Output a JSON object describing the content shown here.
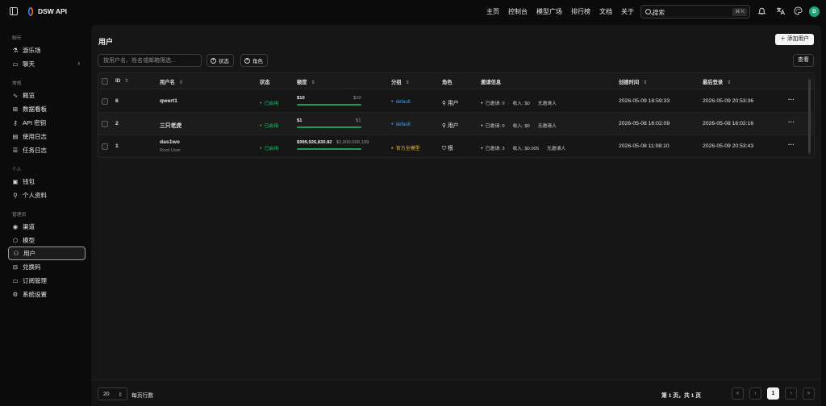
{
  "app": {
    "title": "DSW API",
    "user_initial": "D"
  },
  "topnav": [
    "主页",
    "控制台",
    "模型广场",
    "排行榜",
    "文档",
    "关于"
  ],
  "search": {
    "placeholder": "搜索",
    "shortcut": "⌘ K"
  },
  "sidebar": {
    "sections": {
      "chat": "聊天",
      "console": "常规",
      "personal": "个人",
      "admin": "管理员"
    },
    "items": [
      {
        "label": "游乐场",
        "icon": "flask-icon"
      },
      {
        "label": "聊天",
        "icon": "message-icon"
      },
      {
        "label": "概览",
        "icon": "activity-icon"
      },
      {
        "label": "数据看板",
        "icon": "grid-icon"
      },
      {
        "label": "API 密钥",
        "icon": "key-icon"
      },
      {
        "label": "使用日志",
        "icon": "doc-icon"
      },
      {
        "label": "任务日志",
        "icon": "list-icon"
      },
      {
        "label": "钱包",
        "icon": "wallet-icon"
      },
      {
        "label": "个人资料",
        "icon": "user-icon"
      },
      {
        "label": "渠道",
        "icon": "signal-icon"
      },
      {
        "label": "模型",
        "icon": "cube-icon"
      },
      {
        "label": "用户",
        "icon": "users-icon"
      },
      {
        "label": "兑换码",
        "icon": "ticket-icon"
      },
      {
        "label": "订阅管理",
        "icon": "card-icon"
      },
      {
        "label": "系统设置",
        "icon": "gear-icon"
      }
    ]
  },
  "page": {
    "title": "用户",
    "add_button": "添加用户",
    "filter_placeholder": "按用户名、姓名或邮箱筛选...",
    "chip_status": "状态",
    "chip_role": "角色",
    "view_button": "查看"
  },
  "table": {
    "headers": {
      "id": "ID",
      "username": "用户名",
      "status": "状态",
      "quota": "额度",
      "group": "分组",
      "role": "角色",
      "invite": "邀请信息",
      "created": "创建时间",
      "last_login": "最后登录"
    },
    "rows": [
      {
        "id": "6",
        "username": "qwert1",
        "subtitle": "",
        "status": "已启用",
        "quota_used": "$10",
        "quota_total": "$10",
        "quota_fraction": 1.0,
        "group": "default",
        "role": "用户",
        "invited": "已邀请: 0",
        "income": "收入: $0",
        "inviter": "无邀请人",
        "created": "2026-05-09 18:59:33",
        "last_login": "2026-05-09 20:53:36"
      },
      {
        "id": "2",
        "username": "三只老虎",
        "subtitle": "",
        "status": "已启用",
        "quota_used": "$1",
        "quota_total": "$1",
        "quota_fraction": 1.0,
        "group": "default",
        "role": "用户",
        "invited": "已邀请: 0",
        "income": "收入: $0",
        "inviter": "无邀请人",
        "created": "2026-05-08 16:02:09",
        "last_login": "2026-05-08 16:02:16"
      },
      {
        "id": "1",
        "username": "das1wo",
        "subtitle": "Root User",
        "status": "已启用",
        "quota_used": "$999,926,830.82",
        "quota_total": "$1,000,000,199",
        "quota_fraction": 0.99993,
        "group": "官方全模型",
        "role": "根",
        "invited": "已邀请: 3",
        "income": "收入: $0.005",
        "inviter": "无邀请人",
        "created": "2026-05-08 11:08:10",
        "last_login": "2026-05-09 20:53:43"
      }
    ]
  },
  "footer": {
    "page_size": "20",
    "rows_per_page": "每页行数",
    "page_info": "第 1 页，共 1 页",
    "current_page": "1"
  },
  "colors": {
    "accent_green": "#20c56b",
    "group_blue": "#3aa0ff",
    "group_gold": "#f1b821",
    "avatar": "#1fa37a"
  }
}
